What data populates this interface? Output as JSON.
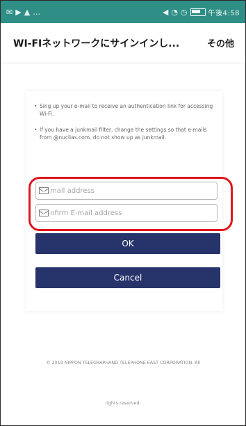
{
  "status_bar": {
    "left_icons": [
      "notification-icon",
      "cast-icon",
      "warning-icon"
    ],
    "right_icons": [
      "mute-icon",
      "wifi-icon",
      "alarm-icon",
      "battery-icon"
    ],
    "time": "午後4:58",
    "accent_color": "#2f8f86"
  },
  "header": {
    "title": "WI-FIネットワークにサインインし...",
    "menu_label": "その他"
  },
  "content": {
    "notes": [
      "Sing up your e-mail to receive an authentication link for accessing Wi-Fi.",
      "If you have a junkmail filter, change the settings so that e-mails from @nuclias.com. do not show up as junkmail."
    ],
    "email_field": {
      "placeholder": "mail address",
      "value": ""
    },
    "confirm_email_field": {
      "placeholder": "nfirm E-mail address",
      "value": ""
    },
    "ok_label": "OK",
    "cancel_label": "Cancel",
    "button_color": "#27336b",
    "highlight_color": "#e0161e"
  },
  "footer": {
    "copyright": "© 2019 NIPPON TELEGRAPHAND TELEPHONE EAST CORPORATION. All",
    "rights": "rights reserved."
  }
}
